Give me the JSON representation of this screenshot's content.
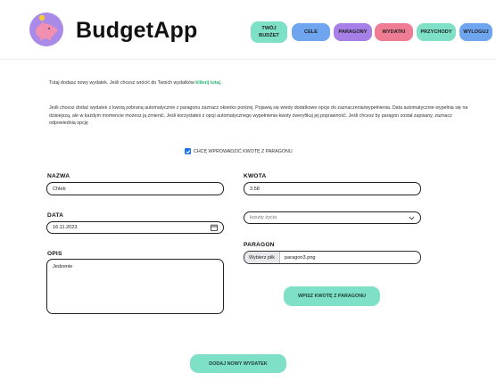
{
  "app": {
    "brand": "BudgetApp",
    "colors": {
      "accent": "#7ee0c6",
      "cele": "#6ea5ee",
      "paragony": "#a680e6",
      "wydatki": "#ee7c93",
      "przychody": "#7ee0c6",
      "wyloguj": "#6ea5ee"
    },
    "logo_icon": "piggy-bank-icon"
  },
  "nav": {
    "budget_line1": "TWÓJ",
    "budget_line2": "BUDŻET",
    "cele": "CELE",
    "paragony": "PARAGONY",
    "wydatki": "WYDATKI",
    "przychody": "PRZYCHODY",
    "wyloguj": "WYLOGUJ"
  },
  "intro": {
    "text": "Tutaj dodasz nowy wydatek. Jeśli chcesz wrócić do Twoich wydatków ",
    "link": "kliknij tutaj."
  },
  "description": "Jeśli chcesz dodać wydatek z kwotą pobraną automatycznie z paragonu zaznacz okienko poniżej. Pojawią się wtedy dodatkowe opcje do zaznaczenia/wypełnienia. Data automatycznie wypełnia się na dzisiejszą, ale w każdym momencie możesz ją zmienić. Jeśli korzystałeś z opcji automatycznego wypełnienia kwoty zweryfikuj jej poprawność. Jeśli chcesz by paragon został zapisany, zaznacz odpowiednią opcję",
  "checkbox": {
    "label": "CHCĘ WPROWADZIĆ KWOTĘ Z PARAGONU",
    "checked": true
  },
  "form": {
    "name_label": "NAZWA",
    "name_value": "Chleb",
    "amount_label": "KWOTA",
    "amount_value": "3.58",
    "date_label": "DATA",
    "date_value": "16.11.2023",
    "category_value": "koszty życia",
    "description_label": "OPIS",
    "description_value": "Jedzenie",
    "receipt_label": "PARAGON",
    "file_button": "Wybierz plik",
    "file_name": "paragon3.png",
    "fill_amount_button": "WPISZ KWOTĘ Z PARAGONU",
    "submit_button": "DODAJ NOWY WYDATEK"
  }
}
